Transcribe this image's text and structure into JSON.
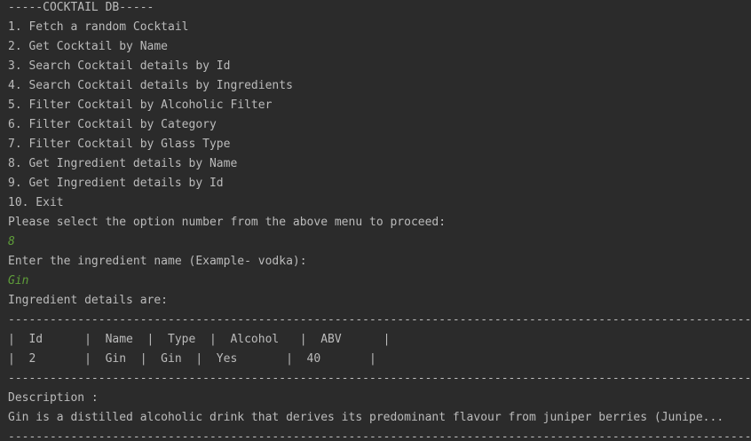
{
  "console": {
    "header": "-----COCKTAIL DB-----",
    "menu": [
      "1. Fetch a random Cocktail",
      "2. Get Cocktail by Name",
      "3. Search Cocktail details by Id",
      "4. Search Cocktail details by Ingredients",
      "5. Filter Cocktail by Alcoholic Filter",
      "6. Filter Cocktail by Category",
      "7. Filter Cocktail by Glass Type",
      "8. Get Ingredient details by Name",
      "9. Get Ingredient details by Id",
      "10. Exit"
    ],
    "prompt_option": "Please select the option number from the above menu to proceed:",
    "input_option": "8",
    "prompt_ingredient": "Enter the ingredient name (Example- vodka):",
    "input_ingredient": "Gin",
    "details_heading": "Ingredient details are:",
    "separator": "--------------------------------------------------------------------------------------------------------------",
    "table_header": "|  Id      |  Name  |  Type  |  Alcohol   |  ABV      |",
    "table_row": "|  2       |  Gin  |  Gin  |  Yes       |  40       |",
    "description_label": "Description :",
    "description_text": "Gin is a distilled alcoholic drink that derives its predominant flavour from juniper berries (Junipe..."
  },
  "colors": {
    "background": "#2b2b2b",
    "text": "#bbbbbb",
    "user_input": "#5f9e3a"
  }
}
